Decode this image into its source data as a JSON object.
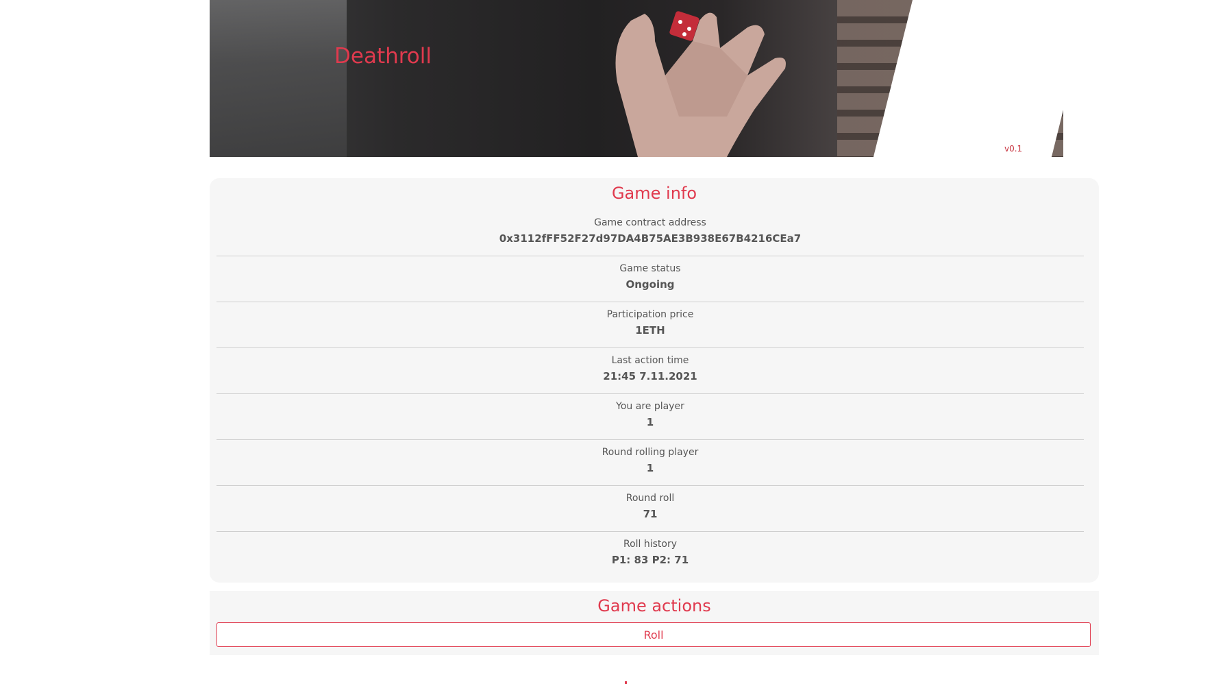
{
  "header": {
    "title": "Deathroll",
    "version": "v0.1"
  },
  "game_info": {
    "title": "Game info",
    "rows": [
      {
        "label": "Game contract address",
        "value": "0x3112fFF52F27d97DA4B75AE3B938E67B4216CEa7"
      },
      {
        "label": "Game status",
        "value": "Ongoing"
      },
      {
        "label": "Participation price",
        "value": "1ETH"
      },
      {
        "label": "Last action time",
        "value": "21:45 7.11.2021"
      },
      {
        "label": "You are player",
        "value": "1"
      },
      {
        "label": "Round rolling player",
        "value": "1"
      },
      {
        "label": "Round roll",
        "value": "71"
      },
      {
        "label": "Roll history",
        "value": "P1: 83 P2: 71"
      }
    ]
  },
  "game_actions": {
    "title": "Game actions",
    "roll_label": "Roll"
  },
  "colors": {
    "accent": "#e03a4e",
    "card_bg": "#f6f6f6",
    "text": "#555555"
  }
}
